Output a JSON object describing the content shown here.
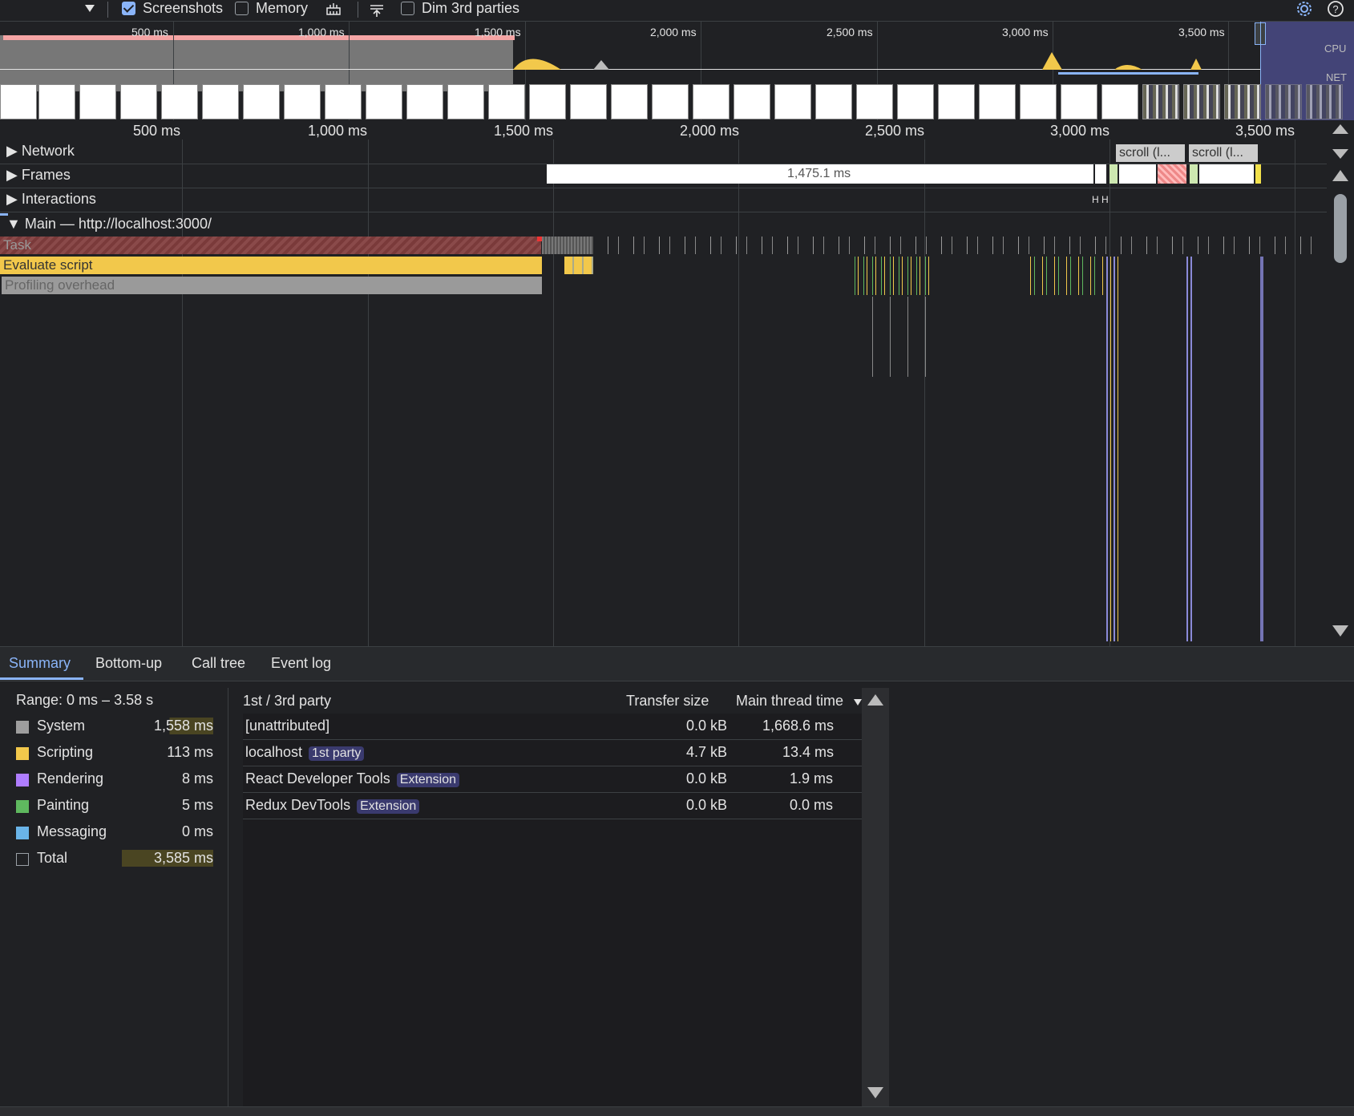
{
  "toolbar": {
    "screenshots_label": "Screenshots",
    "memory_label": "Memory",
    "dim_label": "Dim 3rd parties"
  },
  "overview": {
    "ticks": [
      "500 ms",
      "1,000 ms",
      "1,500 ms",
      "2,000 ms",
      "2,500 ms",
      "3,000 ms",
      "3,500 ms"
    ],
    "cpu_label": "CPU",
    "net_label": "NET"
  },
  "ruler": {
    "ticks": [
      "500 ms",
      "1,000 ms",
      "1,500 ms",
      "2,000 ms",
      "2,500 ms",
      "3,000 ms",
      "3,500 ms"
    ]
  },
  "tracks": {
    "network": "Network",
    "frames": "Frames",
    "frames_duration": "1,475.1 ms",
    "scroll_1": "scroll (l...",
    "scroll_2": "scroll (l...",
    "interactions": "Interactions",
    "main": "Main — http://localhost:3000/",
    "task": "Task",
    "evaluate_script": "Evaluate script",
    "profiling_overhead": "Profiling overhead"
  },
  "tabs": [
    "Summary",
    "Bottom-up",
    "Call tree",
    "Event log"
  ],
  "summary": {
    "range": "Range: 0 ms – 3.58 s",
    "items": [
      {
        "label": "System",
        "value": "1,558 ms",
        "color": "#9e9e9e"
      },
      {
        "label": "Scripting",
        "value": "113 ms",
        "color": "#f2c84b"
      },
      {
        "label": "Rendering",
        "value": "8 ms",
        "color": "#af7dff"
      },
      {
        "label": "Painting",
        "value": "5 ms",
        "color": "#5fb85f"
      },
      {
        "label": "Messaging",
        "value": "0 ms",
        "color": "#6ab4e8"
      },
      {
        "label": "Total",
        "value": "3,585 ms",
        "color": "transparent"
      }
    ]
  },
  "table": {
    "headers": {
      "party": "1st / 3rd party",
      "transfer": "Transfer size",
      "main_thread": "Main thread time"
    },
    "rows": [
      {
        "name": "[unattributed]",
        "badge": "",
        "transfer": "0.0 kB",
        "time": "1,668.6 ms"
      },
      {
        "name": "localhost",
        "badge": "1st party",
        "transfer": "4.7 kB",
        "time": "13.4 ms"
      },
      {
        "name": "React Developer Tools",
        "badge": "Extension",
        "transfer": "0.0 kB",
        "time": "1.9 ms"
      },
      {
        "name": "Redux DevTools",
        "badge": "Extension",
        "transfer": "0.0 kB",
        "time": "0.0 ms"
      }
    ]
  }
}
